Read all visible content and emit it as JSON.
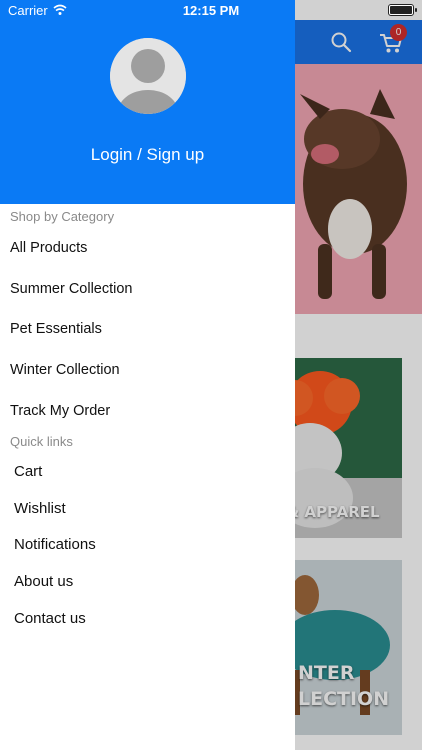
{
  "status_bar": {
    "carrier": "Carrier",
    "time": "12:15 PM"
  },
  "background": {
    "cart_count": "0",
    "card1_text": "Y & APPAREL",
    "card2_line1": "NTER",
    "card2_line2": "LECTION",
    "colors": {
      "header": "#1a73e8",
      "badge": "#d32f2f"
    },
    "icons": [
      "search-icon",
      "cart-icon"
    ]
  },
  "drawer": {
    "login_label": "Login / Sign up",
    "category_title": "Shop by Category",
    "categories": [
      "All Products",
      "Summer Collection",
      "Pet Essentials",
      "Winter Collection",
      "Track My Order"
    ],
    "quick_links_title": "Quick links",
    "quick_links": [
      "Cart",
      "Wishlist",
      "Notifications",
      "About us",
      "Contact us"
    ],
    "colors": {
      "header": "#0a7af5"
    },
    "icons": [
      "avatar-icon"
    ]
  }
}
